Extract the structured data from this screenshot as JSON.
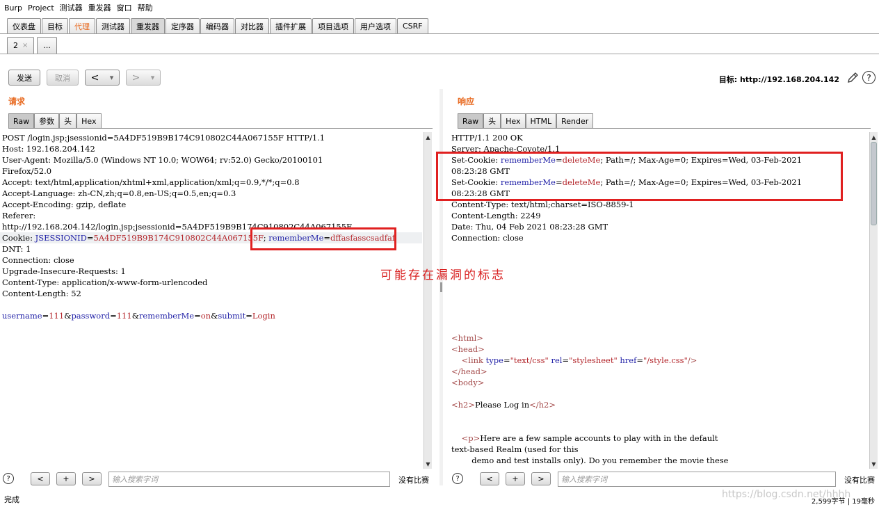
{
  "menu": [
    "Burp",
    "Project",
    "测试器",
    "重发器",
    "窗口",
    "帮助"
  ],
  "main_tabs": [
    "仪表盘",
    "目标",
    "代理",
    "测试器",
    "重发器",
    "定序器",
    "编码器",
    "对比器",
    "插件扩展",
    "项目选项",
    "用户选项",
    "CSRF"
  ],
  "repeater_tabs": {
    "first": "2",
    "close": "×",
    "new": "..."
  },
  "toolbar": {
    "send": "发送",
    "cancel": "取消",
    "back": "<",
    "back_drop": "▾",
    "fwd": ">",
    "fwd_drop": "▾",
    "target": "目标: http://192.168.204.142",
    "help": "?"
  },
  "request": {
    "title": "请求",
    "tabs": [
      "Raw",
      "参数",
      "头",
      "Hex"
    ],
    "lines": [
      "POST /login.jsp;jsessionid=5A4DF519B9B174C910802C44A067155F HTTP/1.1",
      "Host: 192.168.204.142",
      "User-Agent: Mozilla/5.0 (Windows NT 10.0; WOW64; rv:52.0) Gecko/20100101",
      "Firefox/52.0",
      "Accept: text/html,application/xhtml+xml,application/xml;q=0.9,*/*;q=0.8",
      "Accept-Language: zh-CN,zh;q=0.8,en-US;q=0.5,en;q=0.3",
      "Accept-Encoding: gzip, deflate",
      "Referer:",
      "http://192.168.204.142/login.jsp;jsessionid=5A4DF519B9B174C910802C44A067155F"
    ],
    "cookie": {
      "prefix": "Cookie: ",
      "k1": "JSESSIONID",
      "eq": "=",
      "v1": "5A4DF519B9B174C910802C44A067155F",
      "sep": "; ",
      "k2": "rememberMe",
      "v2": "dffasfasscsadfaf"
    },
    "lines_after": [
      "DNT: 1",
      "Connection: close",
      "Upgrade-Insecure-Requests: 1",
      "Content-Type: application/x-www-form-urlencoded",
      "Content-Length: 52",
      ""
    ],
    "body": {
      "k1": "username",
      "v1": "111",
      "k2": "password",
      "v2": "111",
      "k3": "rememberMe",
      "v3": "on",
      "k4": "submit",
      "v4": "Login",
      "eq": "=",
      "amp": "&"
    }
  },
  "response": {
    "title": "响应",
    "tabs": [
      "Raw",
      "头",
      "Hex",
      "HTML",
      "Render"
    ],
    "lines_before": [
      "HTTP/1.1 200 OK",
      "Server: Apache-Coyote/1.1"
    ],
    "set_cookie": {
      "prefix": "Set-Cookie: ",
      "k": "rememberMe",
      "eq": "=",
      "v": "deleteMe",
      "rest": "; Path=/; Max-Age=0; Expires=Wed, 03-Feb-2021",
      "time": "08:23:28 GMT"
    },
    "lines_after": [
      "Content-Type: text/html;charset=ISO-8859-1",
      "Content-Length: 2249",
      "Date: Thu, 04 Feb 2021 08:23:28 GMT",
      "Connection: close"
    ],
    "html": {
      "html_open": "<html>",
      "head_open": "<head>",
      "link_indent": "    ",
      "link_tag": "<link ",
      "link_a1": "type",
      "link_v1": "\"text/css\"",
      "link_a2": "rel",
      "link_v2": "\"stylesheet\"",
      "link_a3": "href",
      "link_v3": "\"/style.css\"",
      "link_close": "/>",
      "head_close": "</head>",
      "body_open": "<body>",
      "h2_open": "<h2>",
      "h2_text": "Please Log in",
      "h2_close": "</h2>",
      "p_indent": "    ",
      "p_open": "<p>",
      "p_text1": "Here are a few sample accounts to play with in the default",
      "p_text2": "text-based Realm (used for this",
      "p_text3": "        demo and test installs only). Do you remember the movie these"
    }
  },
  "annotation": "可能存在漏洞的标志",
  "search": {
    "help": "?",
    "prev": "<",
    "next_plus": "+",
    "next": ">",
    "placeholder": "输入搜索字词",
    "no_match": "没有比赛"
  },
  "status": {
    "left": "完成",
    "right": "2,599字节 | 19毫秒",
    "watermark": "https://blog.csdn.net/hhhh"
  }
}
